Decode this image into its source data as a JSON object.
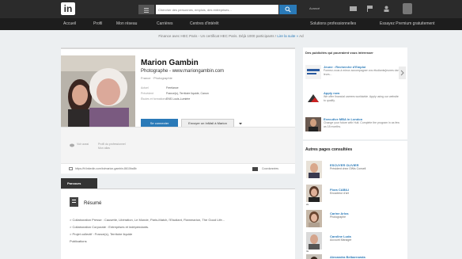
{
  "topbar": {
    "logo": "in",
    "search_placeholder": "Chercher des personnes, emplois, des entreprises...",
    "link": "Avancé"
  },
  "nav": {
    "items": [
      "Accueil",
      "Profil",
      "Mon réseau",
      "Carrières",
      "Centres d'intérêt"
    ],
    "right_items": [
      "Solutions professionnelles",
      "Essayez Premium gratuitement"
    ]
  },
  "banner": {
    "text": "Finance avec HEC Paris - Un certificat HEC Paris. Déjà 1000 participants !",
    "link": "Lire la suite »",
    "close": "Ad"
  },
  "profile": {
    "name": "Marion Gambin",
    "headline": "Photographe - www.mariongambin.com",
    "location": "France · Photographie",
    "info": [
      {
        "label": "Actuel",
        "value": "Freelance"
      },
      {
        "label": "Précédent",
        "value": "France(s), Territoire liquide, Canon"
      },
      {
        "label": "Études et formations",
        "value": "ENS Louis-Lumière"
      }
    ],
    "connect_label": "Se connecter",
    "inmail_label": "Envoyer un InMail à Marion",
    "connections_count": "295",
    "connections_label": "relations"
  },
  "card2": {
    "view_text": "Voir aussi",
    "view_extra_1": "Profil du professionnel",
    "view_extra_2": "Mon alias",
    "url": "https://fr.linkedin.com/in/marion-gambin-8610ba5b",
    "contacts_label": "Coordonnées"
  },
  "section": {
    "tab": "Parcours"
  },
  "resume": {
    "title": "Résumé",
    "p1": "> Collaboration Presse : Causette, Libération, Le Monde, Paris-Match, l'Etudiant, Flammarion, The Good Life...",
    "p2": "> Collaboration Corporate : Entreprises et indépendants.",
    "p3": "> Projet collectif : France(s), Territoire liquide",
    "p4": "Publications"
  },
  "ads": {
    "title": "Des publicités qui pourraient vous intéresser",
    "items": [
      {
        "title": "Jeune : Recherche d'Emploi",
        "text": "Formez-vous à mieux accompagner vos étudiants/jeunes dans leurs..."
      },
      {
        "title": "Apply now",
        "text": "We offer financial careers worldwide. Apply using our website to qualify."
      },
      {
        "title": "Executive MBA in London",
        "text": "Change your future with Hult. Complete the program in as few as 18 months."
      }
    ]
  },
  "other_pages": {
    "title": "Autres pages consultées",
    "people": [
      {
        "name": "ESCUYER OLIVIER",
        "role": "Président chez OWis Conseil",
        "badge": ""
      },
      {
        "name": "Flora CABILI",
        "role": "Encadreur d'art",
        "badge": "2e"
      },
      {
        "name": "Carine Arlos",
        "role": "Photographe",
        "badge": ""
      },
      {
        "name": "Caroline Luda",
        "role": "Account Manager",
        "badge": "3e"
      },
      {
        "name": "Alexandra Belbarrowda",
        "role": "",
        "badge": ""
      }
    ]
  }
}
